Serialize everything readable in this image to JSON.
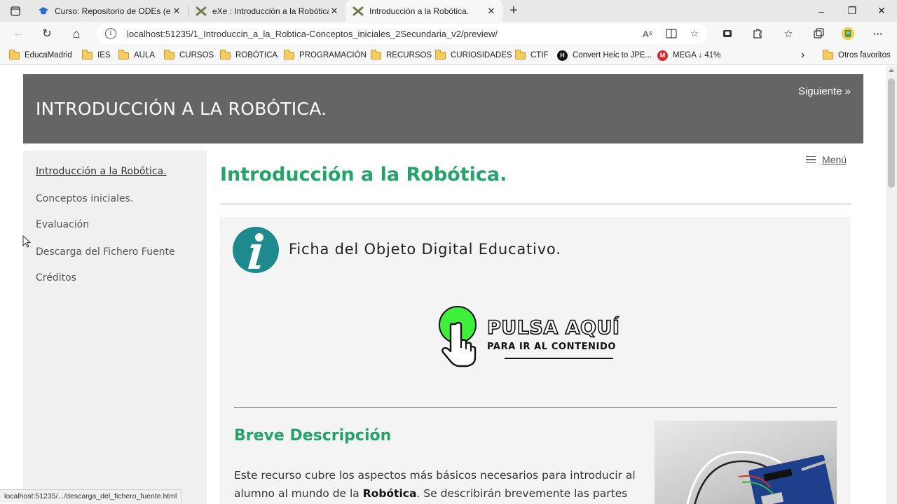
{
  "browser": {
    "tabs": [
      {
        "title": "Curso: Repositorio de ODEs (en p",
        "state": "inactive",
        "icon": "graduation-cap-icon"
      },
      {
        "title": "eXe : Introducción a la Robótica.",
        "state": "inactive",
        "icon": "exe-icon"
      },
      {
        "title": "Introducción a la Robótica.",
        "state": "active",
        "icon": "exe-icon"
      }
    ],
    "new_tab_label": "+",
    "window_controls": {
      "minimize": "–",
      "restore": "❐",
      "close": "✕"
    },
    "nav": {
      "back": "←",
      "reload": "↻",
      "home": "⌂"
    },
    "address": {
      "url": "localhost:51235/1_Introduccin_a_la_Robtica-Conceptos_iniciales_2Secundaria_v2/preview/",
      "info": "i",
      "read_aloud": "A⁵"
    },
    "toolbar_more": "···",
    "bookmarks": [
      {
        "label": "EducaMadrid",
        "kind": "folder"
      },
      {
        "label": "IES",
        "kind": "folder"
      },
      {
        "label": "AULA",
        "kind": "folder"
      },
      {
        "label": "CURSOS",
        "kind": "folder"
      },
      {
        "label": "ROBÓTICA",
        "kind": "folder"
      },
      {
        "label": "PROGRAMACIÓN",
        "kind": "folder"
      },
      {
        "label": "RECURSOS",
        "kind": "folder"
      },
      {
        "label": "CURIOSIDADES",
        "kind": "folder"
      },
      {
        "label": "CTIF",
        "kind": "folder"
      },
      {
        "label": "Convert Heic to JPE...",
        "kind": "site",
        "badge": "H"
      },
      {
        "label": "MEGA ↓ 41%",
        "kind": "site",
        "badge": "M"
      }
    ],
    "bookmarks_overflow": "›",
    "other_favorites": "Otros favoritos",
    "status_url": "localhost:51235/.../descarga_del_fichero_fuente.html"
  },
  "site": {
    "title": "INTRODUCCIÓN A LA ROBÓTICA.",
    "next_label": "Siguiente »",
    "menu_label": "Menú"
  },
  "sidebar": {
    "items": [
      {
        "label": "Introducción a la Robótica.",
        "current": true
      },
      {
        "label": "Conceptos iniciales.",
        "current": false
      },
      {
        "label": "Evaluación",
        "current": false
      },
      {
        "label": "Descarga del Fichero Fuente",
        "current": false
      },
      {
        "label": "Créditos",
        "current": false
      }
    ]
  },
  "main": {
    "page_title": "Introducción a la Robótica.",
    "ficha_heading": "Ficha del Objeto Digital Educativo.",
    "info_glyph": "i",
    "pulsa": {
      "main": "PULSA AQUÍ",
      "sub": "PARA IR AL CONTENIDO"
    },
    "breve_title": "Breve Descripción",
    "description": {
      "part1": "Este recurso cubre los aspectos más básicos necesarios para introducir al alumno al mundo de la ",
      "bold": "Robótica",
      "part2": ". Se describirán brevemente las partes"
    }
  },
  "colors": {
    "accent_green": "#26a369",
    "header_gray": "#666564",
    "info_teal": "#1f8a8e",
    "button_green": "#3ef03b"
  }
}
